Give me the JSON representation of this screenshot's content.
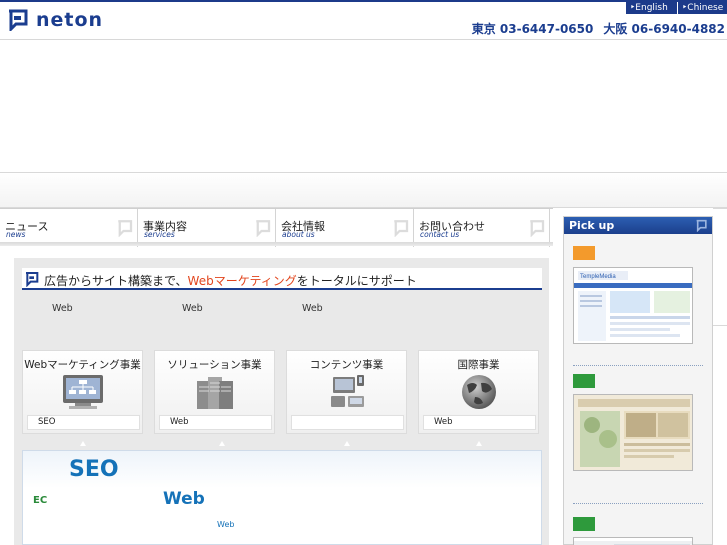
{
  "header": {
    "logo_text": "neton",
    "lang_english": "‣English",
    "lang_chinese": "‣Chinese",
    "phone_tokyo": "東京 03-6447-0650",
    "phone_osaka": "大阪 06-6940-4882"
  },
  "nav": {
    "items": [
      {
        "jp": "ニュース",
        "en": "news"
      },
      {
        "jp": "事業内容",
        "en": "services"
      },
      {
        "jp": "会社情報",
        "en": "about us"
      },
      {
        "jp": "お問い合わせ",
        "en": "contact us"
      }
    ]
  },
  "main": {
    "headline_prefix": "広告からサイト構築まで、",
    "headline_accent": "Webマーケティング",
    "headline_suffix": "をトータルにサポート",
    "taglines": [
      "Web",
      "Web",
      "Web"
    ],
    "cards": [
      {
        "title": "Webマーケティング事業",
        "label": "SEO"
      },
      {
        "title": "ソリューション事業",
        "label": "Web"
      },
      {
        "title": "コンテンツ事業",
        "label": ""
      },
      {
        "title": "国際事業",
        "label": "Web"
      }
    ],
    "feature": {
      "seo": "SEO",
      "ec": "EC",
      "web_large": "Web",
      "web_small": "Web"
    }
  },
  "sidebar": {
    "title": "Pick up",
    "tag_colors": [
      "#f39a2c",
      "#2e9a3c",
      "#2e9a3c"
    ]
  },
  "colors": {
    "brand": "#1b3d8f",
    "accent": "#e2451d",
    "feature_blue": "#1572b8"
  }
}
